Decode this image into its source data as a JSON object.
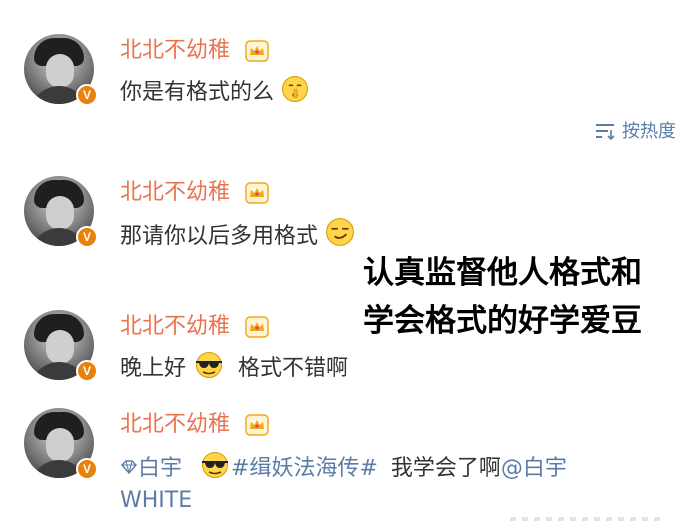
{
  "author_name": "北北不幼稚",
  "sort_label": "按热度",
  "comments": [
    {
      "text": "你是有格式的么"
    },
    {
      "text": "那请你以后多用格式"
    },
    {
      "text_before": "晚上好",
      "text_after": "格式不错啊"
    },
    {
      "mention_prefix": "白宇",
      "hashtag": "#缉妖法海传#",
      "text_mid": "我学会了啊",
      "mention": "@白宇",
      "mention_cont": "WHITE"
    }
  ],
  "overlay_caption": {
    "line1": "认真监督他人格式和",
    "line2": "学会格式的好学爱豆"
  },
  "icons": {
    "crown": "crown-badge-icon",
    "verified": "verified-v-icon",
    "sort": "sort-by-heat-icon",
    "emoji_shush": "shushing-face-emoji",
    "emoji_smirk": "smirking-face-emoji",
    "emoji_cool": "sunglasses-face-emoji",
    "diamond": "diamond-icon"
  },
  "colors": {
    "name": "#eb7350",
    "text": "#333333",
    "link": "#5a7da8",
    "verified": "#e8820c",
    "crown": "#f2a81d"
  }
}
